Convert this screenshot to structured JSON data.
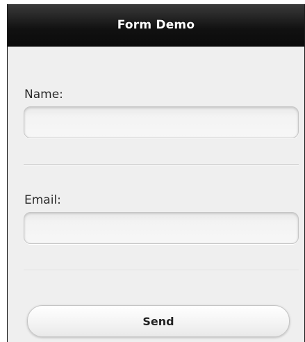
{
  "header": {
    "title": "Form Demo"
  },
  "form": {
    "name_label": "Name:",
    "name_value": "",
    "email_label": "Email:",
    "email_value": "",
    "send_label": "Send"
  },
  "colors": {
    "header_bg": "#111111",
    "page_bg": "#efefef",
    "header_text": "#ffffff"
  }
}
